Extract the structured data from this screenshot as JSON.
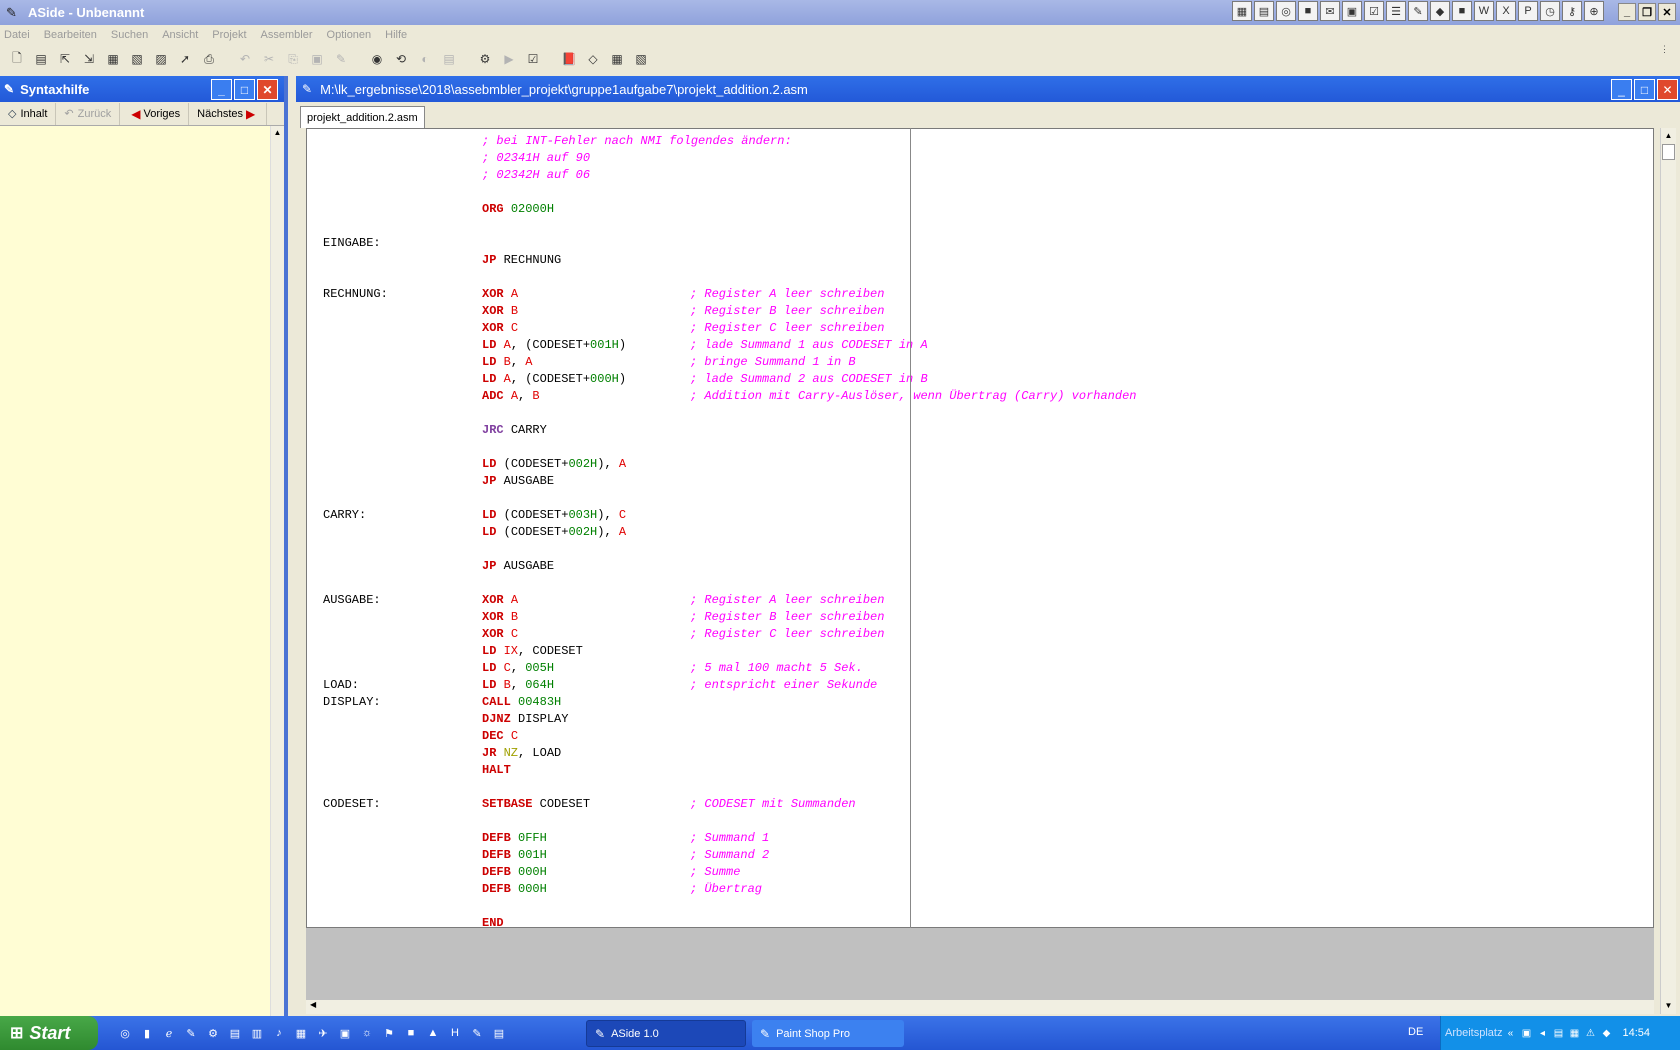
{
  "window": {
    "title": "ASide - Unbenannt"
  },
  "menu": [
    "Datei",
    "Bearbeiten",
    "Suchen",
    "Ansicht",
    "Projekt",
    "Assembler",
    "Optionen",
    "Hilfe"
  ],
  "syntax_panel": {
    "title": "Syntaxhilfe",
    "nav": {
      "contents": "Inhalt",
      "back": "Zurück",
      "prev": "Voriges",
      "next": "Nächstes"
    }
  },
  "editor": {
    "title": "M:\\lk_ergebnisse\\2018\\assebmbler_projekt\\gruppe1aufgabe7\\projekt_addition.2.asm",
    "tab": "projekt_addition.2.asm",
    "lines": [
      {
        "label": "",
        "mn": "",
        "arg": "",
        "comment": "; bei INT-Fehler nach NMI folgendes ändern:",
        "full": true
      },
      {
        "label": "",
        "mn": "",
        "arg": "",
        "comment": "; 02341H auf 90",
        "full": true
      },
      {
        "label": "",
        "mn": "",
        "arg": "",
        "comment": "; 02342H auf 06",
        "full": true
      },
      {
        "label": "",
        "mn": "",
        "arg": "",
        "comment": ""
      },
      {
        "label": "",
        "mn": "ORG",
        "arg": "02000H",
        "comment": ""
      },
      {
        "label": "",
        "mn": "",
        "arg": "",
        "comment": ""
      },
      {
        "label": "EINGABE:",
        "mn": "",
        "arg": "",
        "comment": ""
      },
      {
        "label": "",
        "mn": "JP",
        "arg": "RECHNUNG",
        "comment": ""
      },
      {
        "label": "",
        "mn": "",
        "arg": "",
        "comment": ""
      },
      {
        "label": "RECHNUNG:",
        "mn": "XOR",
        "arg": "A",
        "comment": "; Register A leer schreiben"
      },
      {
        "label": "",
        "mn": "XOR",
        "arg": "B",
        "comment": "; Register B leer schreiben"
      },
      {
        "label": "",
        "mn": "XOR",
        "arg": "C",
        "comment": "; Register C leer schreiben"
      },
      {
        "label": "",
        "mn": "LD",
        "arg": "A, (CODESET+001H)",
        "comment": "; lade Summand 1 aus CODESET in A"
      },
      {
        "label": "",
        "mn": "LD",
        "arg": "B, A",
        "comment": "; bringe Summand 1 in B"
      },
      {
        "label": "",
        "mn": "LD",
        "arg": "A, (CODESET+000H)",
        "comment": "; lade Summand 2 aus CODESET in B"
      },
      {
        "label": "",
        "mn": "ADC",
        "arg": "A, B",
        "comment": "; Addition mit Carry-Auslöser, wenn Übertrag (Carry) vorhanden"
      },
      {
        "label": "",
        "mn": "",
        "arg": "",
        "comment": ""
      },
      {
        "label": "",
        "mn": "JRC",
        "arg": "CARRY",
        "comment": ""
      },
      {
        "label": "",
        "mn": "",
        "arg": "",
        "comment": ""
      },
      {
        "label": "",
        "mn": "LD",
        "arg": "(CODESET+002H), A",
        "comment": ""
      },
      {
        "label": "",
        "mn": "JP",
        "arg": "AUSGABE",
        "comment": ""
      },
      {
        "label": "",
        "mn": "",
        "arg": "",
        "comment": ""
      },
      {
        "label": "CARRY:",
        "mn": "LD",
        "arg": "(CODESET+003H), C",
        "comment": ""
      },
      {
        "label": "",
        "mn": "LD",
        "arg": "(CODESET+002H), A",
        "comment": ""
      },
      {
        "label": "",
        "mn": "",
        "arg": "",
        "comment": ""
      },
      {
        "label": "",
        "mn": "JP",
        "arg": "AUSGABE",
        "comment": ""
      },
      {
        "label": "",
        "mn": "",
        "arg": "",
        "comment": ""
      },
      {
        "label": "AUSGABE:",
        "mn": "XOR",
        "arg": "A",
        "comment": "; Register A leer schreiben"
      },
      {
        "label": "",
        "mn": "XOR",
        "arg": "B",
        "comment": "; Register B leer schreiben"
      },
      {
        "label": "",
        "mn": "XOR",
        "arg": "C",
        "comment": "; Register C leer schreiben"
      },
      {
        "label": "",
        "mn": "LD",
        "arg": "IX, CODESET",
        "comment": ""
      },
      {
        "label": "",
        "mn": "LD",
        "arg": "C, 005H",
        "comment": "; 5 mal 100 macht 5 Sek."
      },
      {
        "label": "LOAD:",
        "mn": "LD",
        "arg": "B, 064H",
        "comment": "; entspricht einer Sekunde"
      },
      {
        "label": "DISPLAY:",
        "mn": "CALL",
        "arg": "00483H",
        "comment": ""
      },
      {
        "label": "",
        "mn": "DJNZ",
        "arg": "DISPLAY",
        "comment": ""
      },
      {
        "label": "",
        "mn": "DEC",
        "arg": "C",
        "comment": ""
      },
      {
        "label": "",
        "mn": "JR",
        "arg": "NZ, LOAD",
        "comment": ""
      },
      {
        "label": "",
        "mn": "HALT",
        "arg": "",
        "comment": ""
      },
      {
        "label": "",
        "mn": "",
        "arg": "",
        "comment": ""
      },
      {
        "label": "CODESET:",
        "mn": "SETBASE",
        "arg": "CODESET",
        "comment": "; CODESET mit Summanden"
      },
      {
        "label": "",
        "mn": "",
        "arg": "",
        "comment": ""
      },
      {
        "label": "",
        "mn": "DEFB",
        "arg": "0FFH",
        "comment": "; Summand 1"
      },
      {
        "label": "",
        "mn": "DEFB",
        "arg": "001H",
        "comment": "; Summand 2"
      },
      {
        "label": "",
        "mn": "DEFB",
        "arg": "000H",
        "comment": "; Summe"
      },
      {
        "label": "",
        "mn": "DEFB",
        "arg": "000H",
        "comment": "; Übertrag"
      },
      {
        "label": "",
        "mn": "",
        "arg": "",
        "comment": ""
      },
      {
        "label": "",
        "mn": "END",
        "arg": "",
        "comment": ""
      }
    ]
  },
  "taskbar": {
    "start": "Start",
    "tasks": [
      "ASide 1.0",
      "Paint Shop Pro"
    ],
    "language": "DE",
    "tray_label": "Arbeitsplatz",
    "clock": "14:54"
  }
}
